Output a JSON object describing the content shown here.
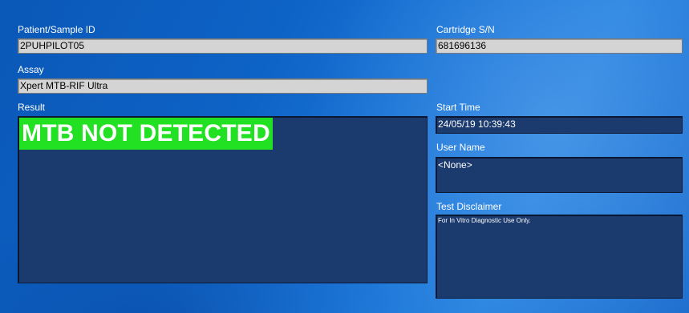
{
  "patient": {
    "label": "Patient/Sample ID",
    "value": "2PUHPILOT05"
  },
  "cartridge": {
    "label": "Cartridge S/N",
    "value": "681696136"
  },
  "assay": {
    "label": "Assay",
    "value": "Xpert MTB-RIF Ultra"
  },
  "result": {
    "label": "Result",
    "value": "MTB NOT DETECTED",
    "highlight_color": "#22e022"
  },
  "start_time": {
    "label": "Start Time",
    "value": "24/05/19 10:39:43"
  },
  "user_name": {
    "label": "User Name",
    "value": "<None>"
  },
  "disclaimer": {
    "label": "Test Disclaimer",
    "value": "For In Vitro Diagnostic Use Only."
  },
  "colors": {
    "background": "#0e63c6",
    "field_gray": "#d4d4d4",
    "field_navy": "#1b3a6e"
  }
}
